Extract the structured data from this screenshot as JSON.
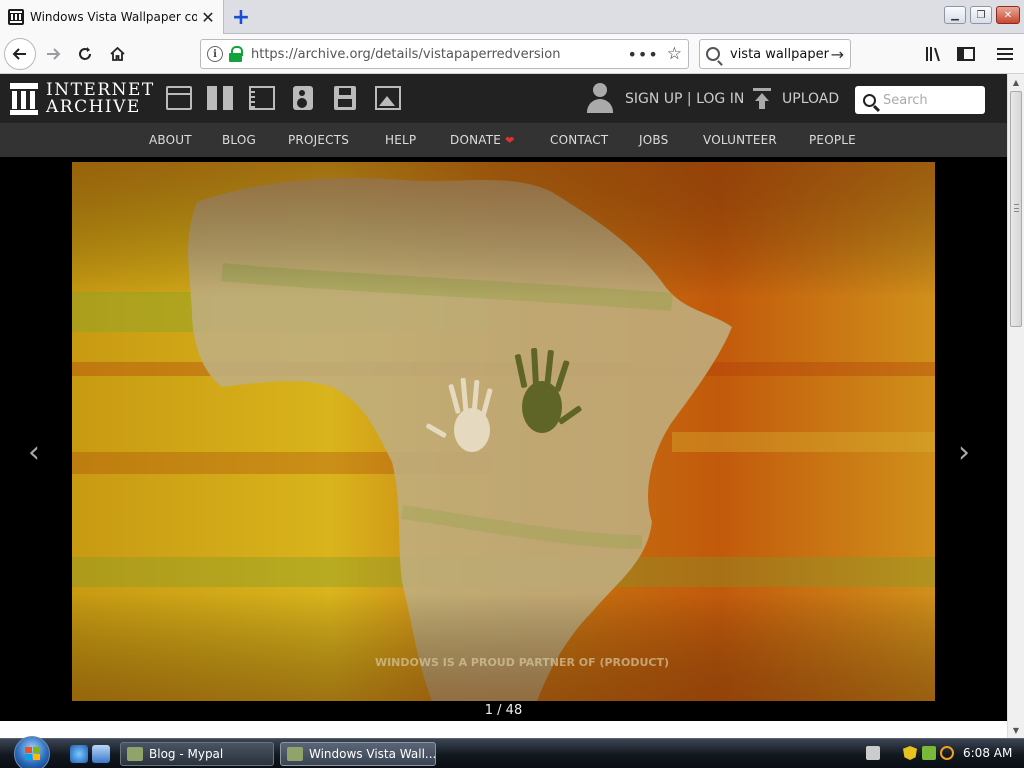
{
  "browser": {
    "tab_title": "Windows Vista Wallpaper colle",
    "url": "https://archive.org/details/vistapaperredversion",
    "search_value": "vista wallpaper"
  },
  "archive": {
    "logo_line1": "INTERNET",
    "logo_line2": "ARCHIVE",
    "signup_login": "SIGN UP | LOG IN",
    "upload": "UPLOAD",
    "search_placeholder": "Search",
    "nav": [
      "ABOUT",
      "BLOG",
      "PROJECTS",
      "HELP",
      "DONATE",
      "CONTACT",
      "JOBS",
      "VOLUNTEER",
      "PEOPLE"
    ]
  },
  "viewer": {
    "counter": "1 / 48",
    "prev_arrow": "‹",
    "next_arrow": "›",
    "wallpaper_caption": "WINDOWS IS A PROUD PARTNER OF (PRODUCT)"
  },
  "taskbar": {
    "items": [
      "Blog - Mypal",
      "Windows Vista Wall..."
    ],
    "clock": "6:08 AM"
  },
  "colors": {
    "header_bg": "#222222",
    "nav_bg": "#333333",
    "heart": "#e03030",
    "lock_green": "#12a43a"
  }
}
